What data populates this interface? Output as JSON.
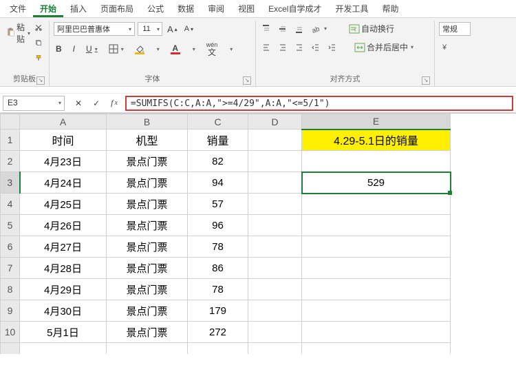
{
  "tabs": {
    "file": "文件",
    "home": "开始",
    "insert": "插入",
    "layout": "页面布局",
    "formulas": "公式",
    "data": "数据",
    "review": "审阅",
    "view": "视图",
    "selfstudy": "Excel自学成才",
    "devtools": "开发工具",
    "help": "帮助"
  },
  "ribbon": {
    "clipboard": {
      "paste": "粘贴",
      "group": "剪贴板"
    },
    "font": {
      "name": "阿里巴巴普惠体",
      "size": "11",
      "group": "字体",
      "bold": "B",
      "italic": "I",
      "underline": "U",
      "ruby": "wén"
    },
    "align": {
      "wrap": "自动换行",
      "merge": "合并后居中",
      "group": "对齐方式"
    },
    "number_group": "常规"
  },
  "fbar": {
    "cellref": "E3",
    "formula": "=SUMIFS(C:C,A:A,\">=4/29\",A:A,\"<=5/1\")"
  },
  "cols": [
    "A",
    "B",
    "C",
    "D",
    "E"
  ],
  "headers": {
    "A": "时间",
    "B": "机型",
    "C": "销量",
    "E": "4.29-5.1日的销量"
  },
  "rows": [
    {
      "n": "2",
      "A": "4月23日",
      "B": "景点门票",
      "C": "82"
    },
    {
      "n": "3",
      "A": "4月24日",
      "B": "景点门票",
      "C": "94",
      "E": "529"
    },
    {
      "n": "4",
      "A": "4月25日",
      "B": "景点门票",
      "C": "57"
    },
    {
      "n": "5",
      "A": "4月26日",
      "B": "景点门票",
      "C": "96"
    },
    {
      "n": "6",
      "A": "4月27日",
      "B": "景点门票",
      "C": "78"
    },
    {
      "n": "7",
      "A": "4月28日",
      "B": "景点门票",
      "C": "86"
    },
    {
      "n": "8",
      "A": "4月29日",
      "B": "景点门票",
      "C": "78"
    },
    {
      "n": "9",
      "A": "4月30日",
      "B": "景点门票",
      "C": "179"
    },
    {
      "n": "10",
      "A": "5月1日",
      "B": "景点门票",
      "C": "272"
    }
  ]
}
